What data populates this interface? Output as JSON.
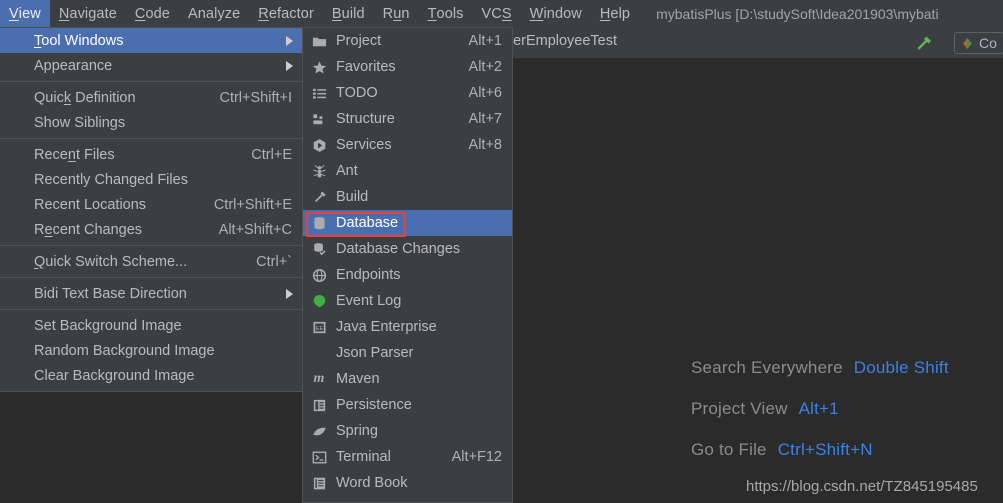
{
  "app": {
    "project_title": "mybatisPlus [D:\\studySoft\\Idea201903\\mybati",
    "bg_color": "#2b2b2b",
    "panel_color": "#3c3f41",
    "highlight_color": "#4b6eaf",
    "accent_link_color": "#3d81e8",
    "annotation_color": "#e8403a"
  },
  "menubar": {
    "items": [
      {
        "label": "View",
        "mnemonic": "V",
        "active": true
      },
      {
        "label": "Navigate",
        "mnemonic": "N",
        "active": false
      },
      {
        "label": "Code",
        "mnemonic": "C",
        "active": false
      },
      {
        "label": "Analyze",
        "mnemonic": "",
        "active": false
      },
      {
        "label": "Refactor",
        "mnemonic": "R",
        "active": false
      },
      {
        "label": "Build",
        "mnemonic": "B",
        "active": false
      },
      {
        "label": "Run",
        "mnemonic": "u",
        "active": false
      },
      {
        "label": "Tools",
        "mnemonic": "T",
        "active": false
      },
      {
        "label": "VCS",
        "mnemonic": "S",
        "active": false
      },
      {
        "label": "Window",
        "mnemonic": "W",
        "active": false
      },
      {
        "label": "Help",
        "mnemonic": "H",
        "active": false
      }
    ]
  },
  "toolbar": {
    "tab_label": "perEmployeeTest",
    "build_icon": "hammer-icon",
    "run_config": {
      "icon": "run-config-icon",
      "label": "Co"
    }
  },
  "view_menu": {
    "groups": [
      {
        "items": [
          {
            "label": "Tool Windows",
            "mnemonic": "T",
            "accel": "",
            "submenu": true,
            "highlighted": true
          },
          {
            "label": "Appearance",
            "mnemonic": "",
            "accel": "",
            "submenu": true,
            "highlighted": false
          }
        ]
      },
      {
        "items": [
          {
            "label": "Quick Definition",
            "mnemonic": "k",
            "accel": "Ctrl+Shift+I",
            "submenu": false,
            "highlighted": false
          },
          {
            "label": "Show Siblings",
            "mnemonic": "",
            "accel": "",
            "submenu": false,
            "highlighted": false
          }
        ]
      },
      {
        "items": [
          {
            "label": "Recent Files",
            "mnemonic": "n",
            "accel": "Ctrl+E",
            "submenu": false,
            "highlighted": false
          },
          {
            "label": "Recently Changed Files",
            "mnemonic": "",
            "accel": "",
            "submenu": false,
            "highlighted": false
          },
          {
            "label": "Recent Locations",
            "mnemonic": "",
            "accel": "Ctrl+Shift+E",
            "submenu": false,
            "highlighted": false
          },
          {
            "label": "Recent Changes",
            "mnemonic": "e",
            "accel": "Alt+Shift+C",
            "submenu": false,
            "highlighted": false
          }
        ]
      },
      {
        "items": [
          {
            "label": "Quick Switch Scheme...",
            "mnemonic": "Q",
            "accel": "Ctrl+`",
            "submenu": false,
            "highlighted": false
          }
        ]
      },
      {
        "items": [
          {
            "label": "Bidi Text Base Direction",
            "mnemonic": "",
            "accel": "",
            "submenu": true,
            "highlighted": false
          }
        ]
      },
      {
        "items": [
          {
            "label": "Set Background Image",
            "mnemonic": "",
            "accel": "",
            "submenu": false,
            "highlighted": false
          },
          {
            "label": "Random Background Image",
            "mnemonic": "",
            "accel": "",
            "submenu": false,
            "highlighted": false
          },
          {
            "label": "Clear Background Image",
            "mnemonic": "",
            "accel": "",
            "submenu": false,
            "highlighted": false
          }
        ]
      }
    ]
  },
  "tool_windows_menu": {
    "items": [
      {
        "label": "Project",
        "accel": "Alt+1",
        "icon": "folder-icon",
        "highlighted": false
      },
      {
        "label": "Favorites",
        "accel": "Alt+2",
        "icon": "star-icon",
        "highlighted": false
      },
      {
        "label": "TODO",
        "accel": "Alt+6",
        "icon": "list-icon",
        "highlighted": false
      },
      {
        "label": "Structure",
        "accel": "Alt+7",
        "icon": "structure-icon",
        "highlighted": false
      },
      {
        "label": "Services",
        "accel": "Alt+8",
        "icon": "services-play-icon",
        "highlighted": false
      },
      {
        "label": "Ant",
        "accel": "",
        "icon": "ant-icon",
        "highlighted": false
      },
      {
        "label": "Build",
        "accel": "",
        "icon": "hammer-icon",
        "highlighted": false
      },
      {
        "label": "Database",
        "accel": "",
        "icon": "database-icon",
        "highlighted": true
      },
      {
        "label": "Database Changes",
        "accel": "",
        "icon": "database-changes-icon",
        "highlighted": false
      },
      {
        "label": "Endpoints",
        "accel": "",
        "icon": "globe-icon",
        "highlighted": false
      },
      {
        "label": "Event Log",
        "accel": "",
        "icon": "event-log-icon",
        "highlighted": false
      },
      {
        "label": "Java Enterprise",
        "accel": "",
        "icon": "java-enterprise-icon",
        "highlighted": false
      },
      {
        "label": "Json Parser",
        "accel": "",
        "icon": "",
        "highlighted": false
      },
      {
        "label": "Maven",
        "accel": "",
        "icon": "maven-icon",
        "highlighted": false
      },
      {
        "label": "Persistence",
        "accel": "",
        "icon": "persistence-icon",
        "highlighted": false
      },
      {
        "label": "Spring",
        "accel": "",
        "icon": "spring-leaf-icon",
        "highlighted": false
      },
      {
        "label": "Terminal",
        "accel": "Alt+F12",
        "icon": "terminal-icon",
        "highlighted": false
      },
      {
        "label": "Word Book",
        "accel": "",
        "icon": "word-book-icon",
        "highlighted": false
      }
    ]
  },
  "hints": {
    "rows": [
      {
        "name": "Search Everywhere",
        "key": "Double Shift"
      },
      {
        "name": "Project View",
        "key": "Alt+1"
      },
      {
        "name": "Go to File",
        "key": "Ctrl+Shift+N"
      }
    ],
    "watermark": "https://blog.csdn.net/TZ845195485"
  }
}
